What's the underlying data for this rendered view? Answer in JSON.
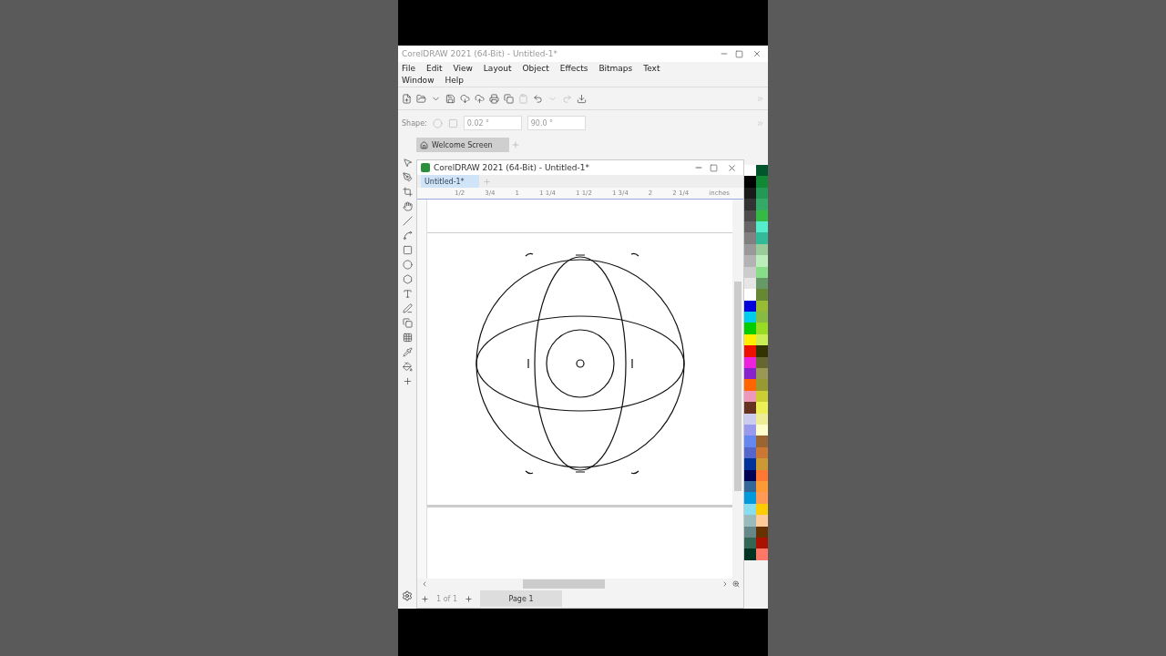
{
  "window": {
    "title": "CorelDRAW 2021 (64-Bit) - Untitled-1*"
  },
  "menu": [
    "File",
    "Edit",
    "View",
    "Layout",
    "Object",
    "Effects",
    "Bitmaps",
    "Text",
    "Window",
    "Help"
  ],
  "property_bar": {
    "label": "Shape:",
    "fields": [
      "0.02 °",
      "90.0 °"
    ]
  },
  "tabs": [
    {
      "label": "Welcome Screen",
      "selected": true
    }
  ],
  "document_window": {
    "title": "CorelDRAW 2021 (64-Bit) - Untitled-1*",
    "tabs": [
      {
        "label": "Untitled-1*",
        "selected": true
      }
    ],
    "ruler": [
      "1/2",
      "3/4",
      "1",
      "1 1/4",
      "1 1/2",
      "1 3/4",
      "2",
      "2 1/4"
    ],
    "ruler_unit": "inches",
    "page_nav": {
      "count": "1 of 1",
      "page": "Page 1"
    }
  },
  "palette": [
    {
      "swatches": [
        {
          "color": "#ffffff"
        },
        {
          "color": "#000000"
        },
        {
          "color": "#1a1a1a"
        },
        {
          "color": "#333333"
        },
        {
          "color": "#4d4d4d"
        },
        {
          "color": "#666666"
        },
        {
          "color": "#808080"
        },
        {
          "color": "#999999"
        },
        {
          "color": "#b3b3b3"
        },
        {
          "color": "#cccccc"
        },
        {
          "color": "#e6e6e6"
        },
        {
          "color": "#ffffff"
        },
        {
          "color": "#0000dd"
        },
        {
          "color": "#00ccee"
        },
        {
          "color": "#00cc00"
        },
        {
          "color": "#ffee00"
        },
        {
          "color": "#ee1100"
        },
        {
          "color": "#ee22dd"
        },
        {
          "color": "#8822cc"
        },
        {
          "color": "#ff6600"
        },
        {
          "color": "#ee99bb"
        },
        {
          "color": "#663322"
        },
        {
          "color": "#ccccee"
        },
        {
          "color": "#9999ee"
        },
        {
          "color": "#6688ee"
        },
        {
          "color": "#5566cc"
        },
        {
          "color": "#003399"
        },
        {
          "color": "#000055"
        },
        {
          "color": "#336699"
        },
        {
          "color": "#0099dd"
        },
        {
          "color": "#88ddee"
        },
        {
          "color": "#99bbbb"
        },
        {
          "color": "#668888"
        },
        {
          "color": "#336655"
        },
        {
          "color": "#003322"
        }
      ]
    },
    {
      "swatches": [
        {
          "color": "#00552a"
        },
        {
          "color": "#118833"
        },
        {
          "color": "#229955"
        },
        {
          "color": "#33aa66"
        },
        {
          "color": "#33bb44"
        },
        {
          "color": "#55eecc"
        },
        {
          "color": "#33bb99"
        },
        {
          "color": "#99cc99"
        },
        {
          "color": "#bbeebb"
        },
        {
          "color": "#88dd88"
        },
        {
          "color": "#669966"
        },
        {
          "color": "#668833"
        },
        {
          "color": "#99bb33"
        },
        {
          "color": "#88bb44"
        },
        {
          "color": "#99dd22"
        },
        {
          "color": "#ccee55"
        },
        {
          "color": "#333300"
        },
        {
          "color": "#666633"
        },
        {
          "color": "#999955"
        },
        {
          "color": "#999933"
        },
        {
          "color": "#cccc33"
        },
        {
          "color": "#eeee55"
        },
        {
          "color": "#eeee99"
        },
        {
          "color": "#ffffcc"
        },
        {
          "color": "#996633"
        },
        {
          "color": "#cc7733"
        },
        {
          "color": "#cc9933"
        },
        {
          "color": "#ff7733"
        },
        {
          "color": "#ff9933"
        },
        {
          "color": "#ff9955"
        },
        {
          "color": "#ffcc00"
        },
        {
          "color": "#ffcc99"
        },
        {
          "color": "#663300"
        },
        {
          "color": "#aa1100"
        },
        {
          "color": "#ff7766"
        }
      ]
    }
  ]
}
